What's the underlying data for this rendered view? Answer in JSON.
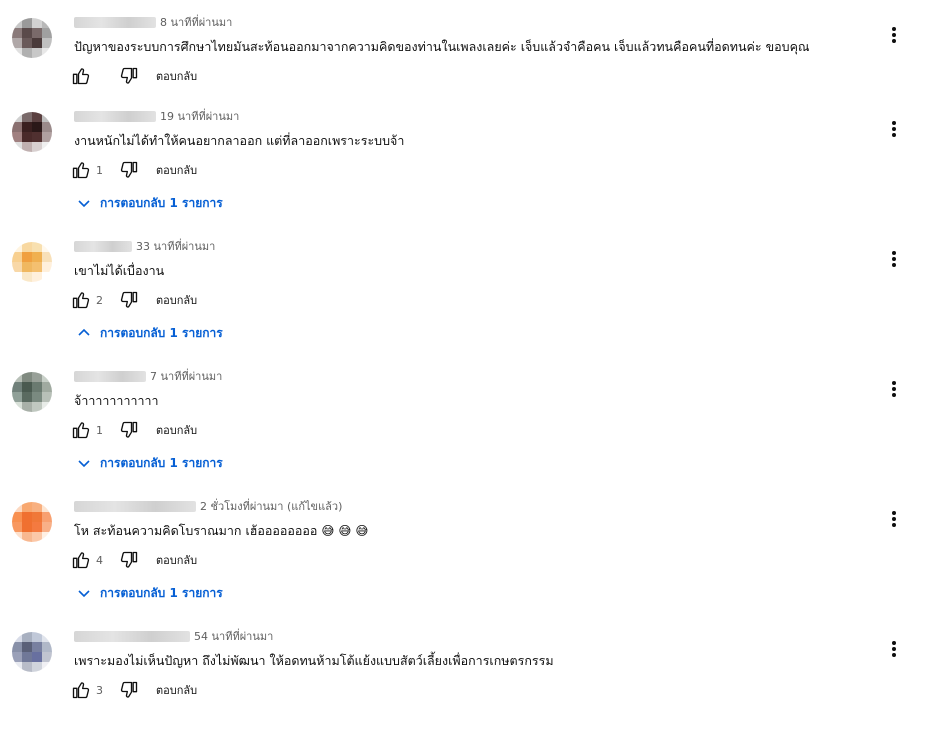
{
  "reply_label": "ตอบกลับ",
  "colors": {
    "accent": "#065fd4",
    "text": "#0f0f0f",
    "muted": "#606060"
  },
  "icons": {
    "like": "thumb-up-icon",
    "dislike": "thumb-down-icon",
    "menu": "more-vert-icon",
    "expand": "chevron-down-icon",
    "collapse": "chevron-up-icon"
  },
  "comments": [
    {
      "time": "8 นาทีที่ผ่านมา",
      "text": "ปัญหาของระบบการศึกษาไทยมันสะท้อนออกมาจากความคิดของท่านในเพลงเลยค่ะ เจ็บแล้วจำคือคน เจ็บแล้วทนคือคนที่อดทนค่ะ ขอบคุณ",
      "likes": "",
      "replies": "",
      "replies_expanded": false
    },
    {
      "time": "19 นาทีที่ผ่านมา",
      "text": "งานหนักไม่ได้ทำให้คนอยากลาออก แต่ที่ลาออกเพราะระบบจ้า",
      "likes": "1",
      "replies": "การตอบกลับ 1 รายการ",
      "replies_expanded": false
    },
    {
      "time": "33 นาทีที่ผ่านมา",
      "text": "เขาไม่ได้เบื่องาน",
      "likes": "2",
      "replies": "การตอบกลับ 1 รายการ",
      "replies_expanded": true
    },
    {
      "time": "7 นาทีที่ผ่านมา",
      "text": "จ้าาาาาาาาาาา",
      "likes": "1",
      "replies": "การตอบกลับ 1 รายการ",
      "replies_expanded": false
    },
    {
      "time": "2 ชั่วโมงที่ผ่านมา (แก้ไขแล้ว)",
      "text": "โห สะท้อนความคิดโบราณมาก เฮ้ออออออออ 😅 😅 😅",
      "likes": "4",
      "replies": "การตอบกลับ 1 รายการ",
      "replies_expanded": false
    },
    {
      "time": "54 นาทีที่ผ่านมา",
      "text": "เพราะมองไม่เห็นปัญหา ถึงไม่พัฒนา ให้อดทนห้ามโต้แย้งแบบสัตว์เลี้ยงเพื่อการเกษตรกรรม",
      "likes": "3",
      "replies": "",
      "replies_expanded": false
    }
  ]
}
